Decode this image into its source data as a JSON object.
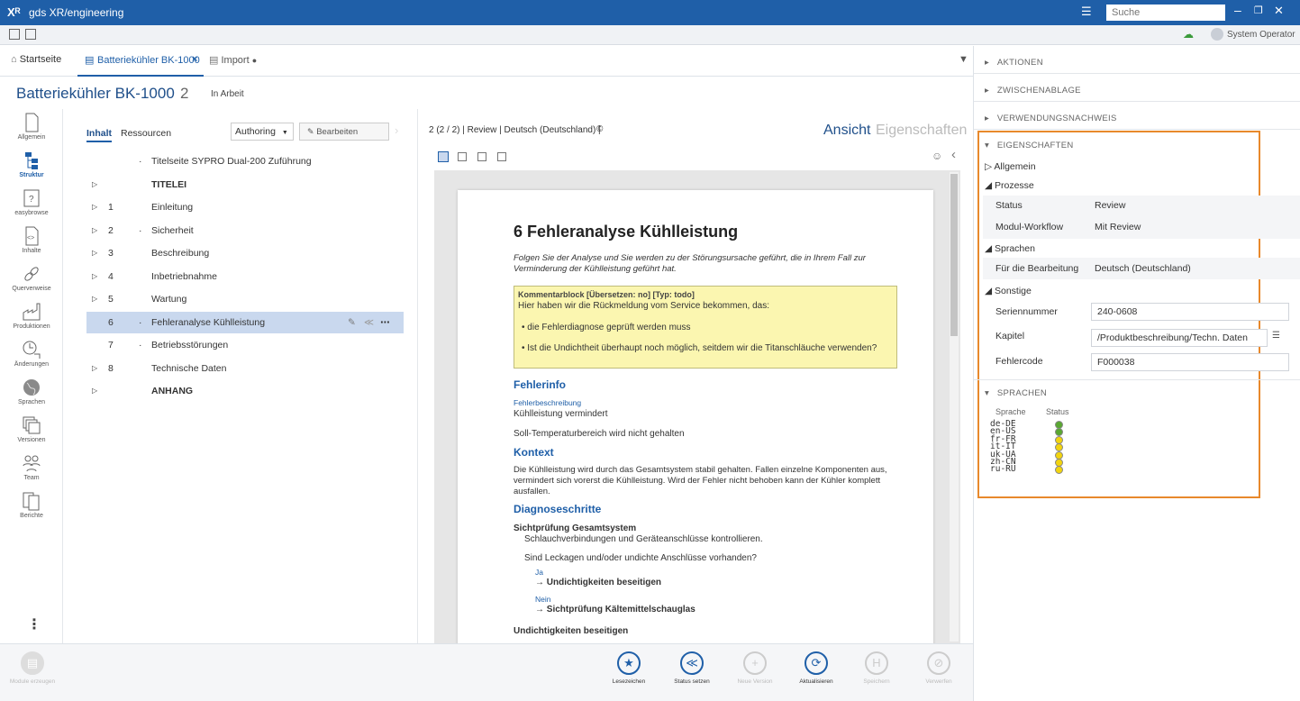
{
  "app": {
    "logo": "Xᴿ",
    "title": "gds XR/engineering",
    "search_placeholder": "Suche",
    "user": "System Operator"
  },
  "tabs": [
    {
      "label": "Startseite"
    },
    {
      "label": "Batteriekühler BK-1000"
    },
    {
      "label": "Import"
    }
  ],
  "header": {
    "title": "Batteriekühler BK-1000",
    "version": "2",
    "status": "In Arbeit"
  },
  "leftnav": [
    "Allgemein",
    "Struktur",
    "easybrowse",
    "Inhalte",
    "Querverweise",
    "Produktionen",
    "Änderungen",
    "Sprachen",
    "Versionen",
    "Team",
    "Berichte"
  ],
  "tree": {
    "tab_content": "Inhalt",
    "tab_resources": "Ressourcen",
    "mode": "Authoring",
    "edit_button": "Bearbeiten",
    "rows": [
      {
        "num": "",
        "label": "Titelseite SYPRO Dual-200 Zuführung",
        "bold": false,
        "dot": true,
        "arrow": false
      },
      {
        "num": "",
        "label": "TITELEI",
        "bold": true,
        "dot": false,
        "arrow": true
      },
      {
        "num": "1",
        "label": "Einleitung",
        "bold": false,
        "dot": false,
        "arrow": true
      },
      {
        "num": "2",
        "label": "Sicherheit",
        "bold": false,
        "dot": true,
        "arrow": true
      },
      {
        "num": "3",
        "label": "Beschreibung",
        "bold": false,
        "dot": false,
        "arrow": true
      },
      {
        "num": "4",
        "label": "Inbetriebnahme",
        "bold": false,
        "dot": false,
        "arrow": true
      },
      {
        "num": "5",
        "label": "Wartung",
        "bold": false,
        "dot": false,
        "arrow": true
      },
      {
        "num": "6",
        "label": "Fehleranalyse Kühlleistung",
        "bold": false,
        "dot": true,
        "arrow": false
      },
      {
        "num": "7",
        "label": "Betriebsstörungen",
        "bold": false,
        "dot": true,
        "arrow": false
      },
      {
        "num": "8",
        "label": "Technische Daten",
        "bold": false,
        "dot": false,
        "arrow": true
      },
      {
        "num": "",
        "label": "ANHANG",
        "bold": true,
        "dot": false,
        "arrow": true
      }
    ]
  },
  "preview": {
    "info": "2 (2 / 2) | Review | Deutsch (Deutschland) |",
    "view_active": "Ansicht",
    "view_inactive": "Eigenschaften",
    "doc": {
      "heading": "6  Fehleranalyse Kühlleistung",
      "intro": "Folgen Sie der Analyse und Sie werden zu der Störungsursache geführt, die in Ihrem Fall zur Verminderung der Kühlleistung geführt hat.",
      "comment_title": "Kommentarblock  [Übersetzen: no] [Typ: todo]",
      "comment_text": "Hier haben wir die Rückmeldung vom Service bekommen, das:",
      "comment_bullet1": "die Fehlerdiagnose geprüft werden muss",
      "comment_bullet2": "Ist die Undichtheit überhaupt noch möglich, seitdem wir die Titanschläuche verwenden?",
      "h_fehlerinfo": "Fehlerinfo",
      "lbl_fehlerbeschreibung": "Fehlerbeschreibung",
      "fehlerbeschreibung": "Kühlleistung vermindert",
      "soll": "Soll-Temperaturbereich wird nicht gehalten",
      "h_kontext": "Kontext",
      "kontext": "Die Kühlleistung wird durch das Gesamtsystem stabil gehalten. Fallen einzelne Komponenten aus, vermindert sich vorerst die Kühlleistung. Wird der Fehler nicht behoben kann der Kühler komplett ausfallen.",
      "h_diagnose": "Diagnoseschritte",
      "step_title": "Sichtprüfung Gesamtsystem",
      "step_text": "Schlauchverbindungen und Geräteanschlüsse kontrollieren.",
      "question": "Sind Leckagen und/oder undichte Anschlüsse vorhanden?",
      "ja": "Ja",
      "ja_action": "→ Undichtigkeiten beseitigen",
      "nein": "Nein",
      "nein_action": "→ Sichtprüfung Kältemittelschauglas",
      "next_title": "Undichtigkeiten beseitigen"
    }
  },
  "bottom": [
    {
      "label": "Module erzeugen",
      "disabled": true
    },
    {
      "label": "Lesezeichen",
      "disabled": false
    },
    {
      "label": "Status setzen",
      "disabled": false
    },
    {
      "label": "Neue Version",
      "disabled": true
    },
    {
      "label": "Aktualisieren",
      "disabled": false
    },
    {
      "label": "Speichern",
      "disabled": true
    },
    {
      "label": "Verwerfen",
      "disabled": true
    }
  ],
  "right": {
    "aktionen": "AKTIONEN",
    "zwischenablage": "ZWISCHENABLAGE",
    "verwendungsnachweis": "VERWENDUNGSNACHWEIS",
    "eigenschaften": "EIGENSCHAFTEN",
    "allgemein": "Allgemein",
    "prozesse": "Prozesse",
    "status_label": "Status",
    "status_value": "Review",
    "workflow_label": "Modul-Workflow",
    "workflow_value": "Mit Review",
    "sprachen_group": "Sprachen",
    "bearbeitung_label": "Für die Bearbeitung",
    "bearbeitung_value": "Deutsch (Deutschland)",
    "sonstige": "Sonstige",
    "serien_label": "Seriennummer",
    "serien_value": "240-0608",
    "kapitel_label": "Kapitel",
    "kapitel_value": "/Produktbeschreibung/Techn. Daten",
    "fehler_label": "Fehlercode",
    "fehler_value": "F000038",
    "sprachen_section": "SPRACHEN",
    "col_sprache": "Sprache",
    "col_status": "Status",
    "languages": [
      {
        "code": "de-DE",
        "color": "#5aa832"
      },
      {
        "code": "en-US",
        "color": "#5aa832"
      },
      {
        "code": "fr-FR",
        "color": "#f2d40f"
      },
      {
        "code": "it-IT",
        "color": "#f2d40f"
      },
      {
        "code": "uk-UA",
        "color": "#f2d40f"
      },
      {
        "code": "zh-CN",
        "color": "#f2d40f"
      },
      {
        "code": "ru-RU",
        "color": "#f2d40f"
      }
    ]
  }
}
